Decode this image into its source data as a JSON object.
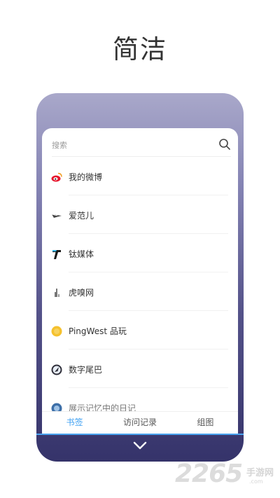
{
  "headline": "简洁",
  "search": {
    "placeholder": "搜索"
  },
  "bookmarks": [
    {
      "label": "我的微博",
      "icon": "weibo-icon"
    },
    {
      "label": "爱范儿",
      "icon": "ifanr-icon"
    },
    {
      "label": "钛媒体",
      "icon": "tmtpost-icon"
    },
    {
      "label": "虎嗅网",
      "icon": "huxiu-icon"
    },
    {
      "label": "PingWest 品玩",
      "icon": "pingwest-icon"
    },
    {
      "label": "数字尾巴",
      "icon": "dgtle-icon"
    },
    {
      "label": "展示记忆中的日记",
      "icon": "diary-icon"
    }
  ],
  "tabs": {
    "bookmarks": "书签",
    "history": "访问记录",
    "groups": "组图"
  },
  "watermark": {
    "number": "2265",
    "suffix": "手游网",
    "domain": ".com"
  },
  "colors": {
    "accent": "#3ea0f2",
    "phone_top": "#a9a8ca",
    "phone_bottom": "#35336a"
  }
}
